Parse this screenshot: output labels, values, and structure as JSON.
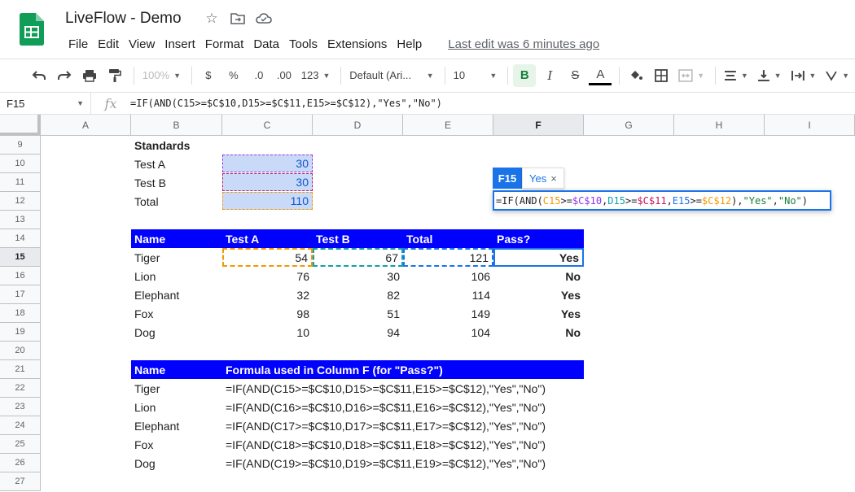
{
  "app": {
    "title": "LiveFlow - Demo",
    "menus": [
      "File",
      "Edit",
      "View",
      "Insert",
      "Format",
      "Data",
      "Tools",
      "Extensions",
      "Help"
    ],
    "last_edit": "Last edit was 6 minutes ago"
  },
  "toolbar": {
    "zoom": "100%",
    "currency": "$",
    "percent": "%",
    "dec_decrease": ".0",
    "dec_increase": ".00",
    "more_formats": "123",
    "font": "Default (Ari...",
    "font_size": "10",
    "bold": "B",
    "italic": "I",
    "strike": "S",
    "text_color": "A"
  },
  "formula_bar": {
    "name_box": "F15",
    "fx": "fx",
    "formula": "=IF(AND(C15>=$C$10,D15>=$C$11,E15>=$C$12),\"Yes\",\"No\")"
  },
  "columns": [
    "A",
    "B",
    "C",
    "D",
    "E",
    "F",
    "G",
    "H",
    "I"
  ],
  "rows": [
    "9",
    "10",
    "11",
    "12",
    "13",
    "14",
    "15",
    "16",
    "17",
    "18",
    "19",
    "20",
    "21",
    "22",
    "23",
    "24",
    "25",
    "26",
    "27"
  ],
  "standards": {
    "title": "Standards",
    "rows": [
      {
        "label": "Test A",
        "value": "30"
      },
      {
        "label": "Test B",
        "value": "30"
      },
      {
        "label": "Total",
        "value": "110"
      }
    ]
  },
  "results": {
    "headers": [
      "Name",
      "Test A",
      "Test B",
      "Total",
      "Pass?"
    ],
    "rows": [
      [
        "Tiger",
        "54",
        "67",
        "121",
        "Yes"
      ],
      [
        "Lion",
        "76",
        "30",
        "106",
        "No"
      ],
      [
        "Elephant",
        "32",
        "82",
        "114",
        "Yes"
      ],
      [
        "Fox",
        "98",
        "51",
        "149",
        "Yes"
      ],
      [
        "Dog",
        "10",
        "94",
        "104",
        "No"
      ]
    ]
  },
  "formulas": {
    "headers": [
      "Name",
      "Formula used in Column F (for \"Pass?\")"
    ],
    "rows": [
      [
        "Tiger",
        "=IF(AND(C15>=$C$10,D15>=$C$11,E15>=$C$12),\"Yes\",\"No\")"
      ],
      [
        "Lion",
        "=IF(AND(C16>=$C$10,D16>=$C$11,E16>=$C$12),\"Yes\",\"No\")"
      ],
      [
        "Elephant",
        "=IF(AND(C17>=$C$10,D17>=$C$11,E17>=$C$12),\"Yes\",\"No\")"
      ],
      [
        "Fox",
        "=IF(AND(C18>=$C$10,D18>=$C$11,E18>=$C$12),\"Yes\",\"No\")"
      ],
      [
        "Dog",
        "=IF(AND(C19>=$C$10,D19>=$C$11,E19>=$C$12),\"Yes\",\"No\")"
      ]
    ]
  },
  "editor": {
    "cell_ref": "F15",
    "preview": "Yes",
    "close": "×",
    "parts": [
      "=IF(AND(",
      "C15",
      ">=",
      "$C$10",
      ",",
      "D15",
      ">=",
      "$C$11",
      ",",
      "E15",
      ">=",
      "$C$12",
      "),",
      "\"Yes\"",
      ",",
      "\"No\"",
      ")"
    ]
  },
  "colors": {
    "header_fill": "#0000ff",
    "standard_fill": "#c9daf8",
    "accent": "#1a73e8",
    "sheets_green": "#0f9d58"
  }
}
